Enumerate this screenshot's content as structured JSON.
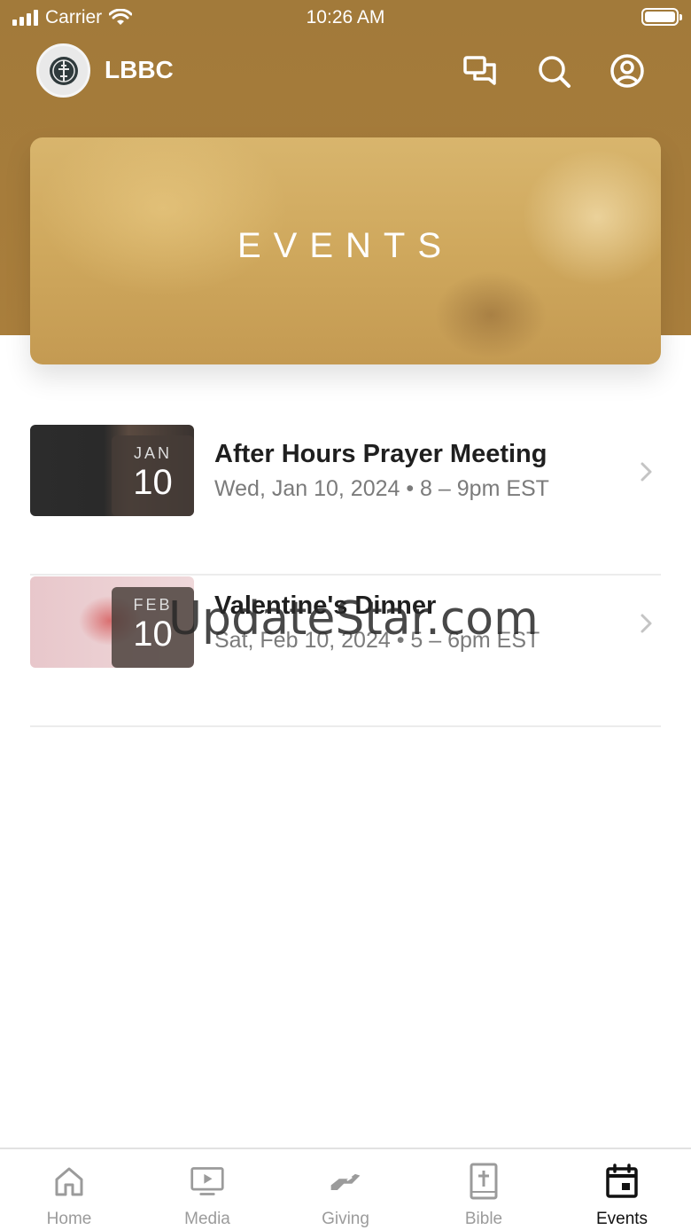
{
  "status_bar": {
    "carrier": "Carrier",
    "time": "10:26 AM"
  },
  "app_bar": {
    "title": "LBBC",
    "icons": [
      "chat-icon",
      "search-icon",
      "profile-icon"
    ]
  },
  "hero": {
    "title": "EVENTS"
  },
  "events": [
    {
      "title": "After Hours Prayer Meeting",
      "meta": "Wed, Jan 10, 2024 • 8 – 9pm EST",
      "month": "JAN",
      "day": "10"
    },
    {
      "title": "Valentine's Dinner",
      "meta": "Sat, Feb 10, 2024 • 5 – 6pm EST",
      "month": "FEB",
      "day": "10"
    }
  ],
  "watermark": "UpdateStar.com",
  "tabs": [
    {
      "label": "Home",
      "icon": "home-icon",
      "active": false
    },
    {
      "label": "Media",
      "icon": "media-icon",
      "active": false
    },
    {
      "label": "Giving",
      "icon": "giving-icon",
      "active": false
    },
    {
      "label": "Bible",
      "icon": "bible-icon",
      "active": false
    },
    {
      "label": "Events",
      "icon": "calendar-icon",
      "active": true
    }
  ],
  "colors": {
    "brand": "#a67c3b",
    "active_tab": "#111111",
    "inactive_tab": "#9b9b9b"
  }
}
